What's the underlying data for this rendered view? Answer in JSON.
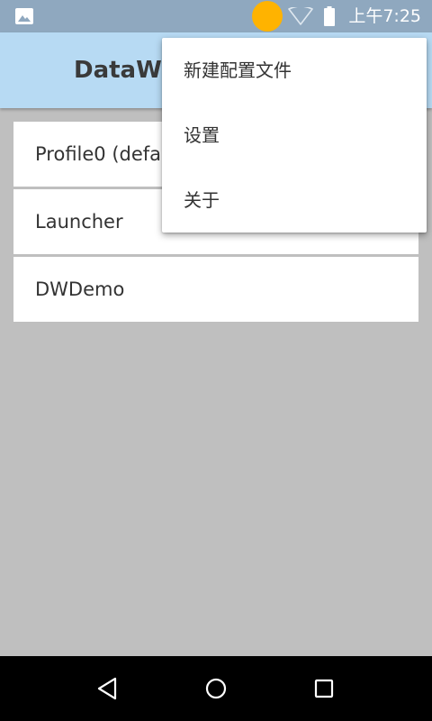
{
  "status_bar": {
    "time": "上午7:25",
    "notification_icon": "image-icon",
    "indicator_icon": "orange-dot-icon",
    "wifi_icon": "wifi-icon",
    "battery_icon": "battery-icon"
  },
  "app_bar": {
    "title": "DataWedge"
  },
  "profiles": [
    {
      "label": "Profile0 (default)"
    },
    {
      "label": "Launcher"
    },
    {
      "label": "DWDemo"
    }
  ],
  "menu": {
    "items": [
      {
        "label": "新建配置文件"
      },
      {
        "label": "设置"
      },
      {
        "label": "关于"
      }
    ]
  },
  "nav_bar": {
    "back_icon": "back-triangle-icon",
    "home_icon": "home-circle-icon",
    "recents_icon": "recents-square-icon"
  },
  "colors": {
    "status_bar": "#8fa8bf",
    "app_bar": "#b7daf3",
    "background": "#bfbfbf",
    "indicator": "#ffb300"
  }
}
